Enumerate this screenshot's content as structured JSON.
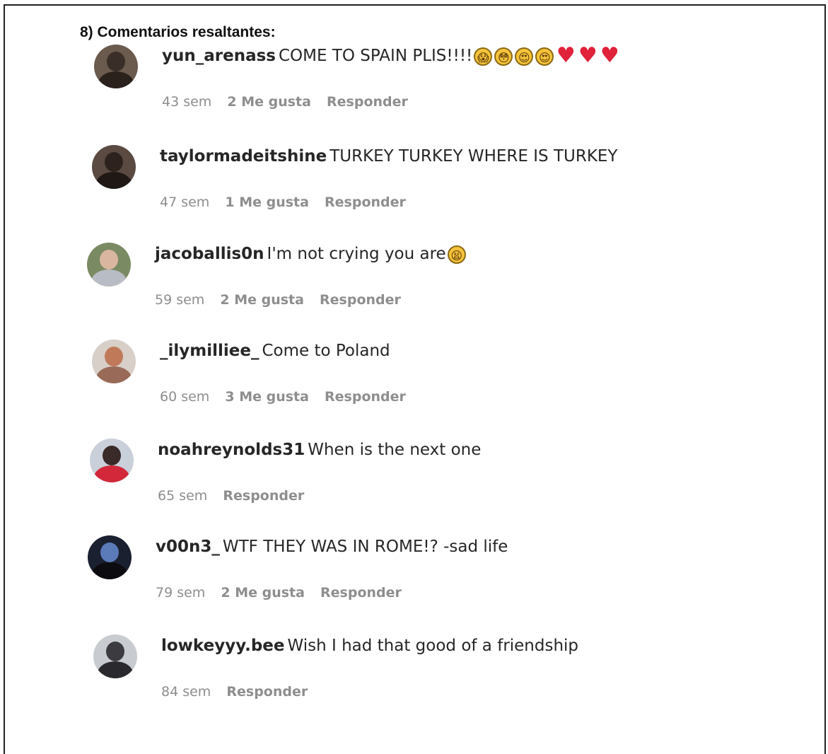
{
  "heading": "8) Comentarios resaltantes:",
  "comments": [
    {
      "user": "yun_arenass",
      "text": "COME TO SPAIN PLIS!!!!",
      "emojis": [
        "screaming-face",
        "flushed-face",
        "heart-eyes-face",
        "heart-eyes-face",
        "red-heart",
        "red-heart",
        "red-heart"
      ],
      "time": "43 sem",
      "likes": "2 Me gusta",
      "reply": "Responder"
    },
    {
      "user": "taylormadeitshine",
      "text": "TURKEY TURKEY WHERE IS TURKEY",
      "time": "47 sem",
      "likes": "1 Me gusta",
      "reply": "Responder"
    },
    {
      "user": "jacoballis0n",
      "text": "I'm not crying you are",
      "emojis": [
        "tired-face"
      ],
      "time": "59 sem",
      "likes": "2 Me gusta",
      "reply": "Responder"
    },
    {
      "user": "_ilymilliee_",
      "text": "Come to Poland",
      "time": "60 sem",
      "likes": "3 Me gusta",
      "reply": "Responder"
    },
    {
      "user": "noahreynolds31",
      "text": "When is the next one",
      "time": "65 sem",
      "reply": "Responder"
    },
    {
      "user": "v00n3_",
      "text": "WTF THEY WAS IN ROME!? -sad life",
      "time": "79 sem",
      "likes": "2 Me gusta",
      "reply": "Responder"
    },
    {
      "user": "lowkeyyy.bee",
      "text": "Wish I had that good of a friendship",
      "time": "84 sem",
      "reply": "Responder"
    }
  ],
  "colors": {
    "meta": "#8e8e8e",
    "text": "#262626",
    "heart": "#e0223a",
    "emoji_face": "#f6c33a"
  }
}
